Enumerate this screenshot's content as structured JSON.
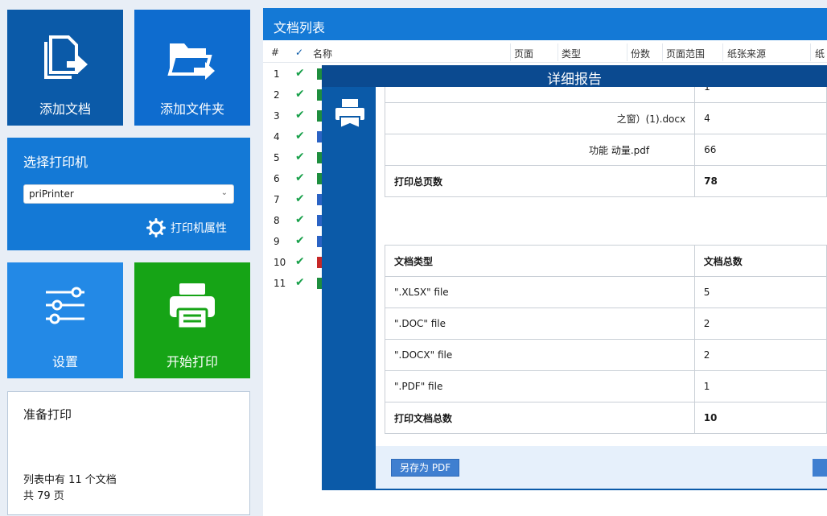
{
  "tiles": {
    "add_document": "添加文档",
    "add_folder": "添加文件夹",
    "settings": "设置",
    "start_print": "开始打印"
  },
  "printer_panel": {
    "title": "选择打印机",
    "selected_printer": "priPrinter",
    "properties_label": "打印机属性"
  },
  "status_panel": {
    "title": "准备打印",
    "doc_count_text": "列表中有 11 个文档",
    "page_count_text": "共 79 页"
  },
  "doc_list": {
    "title": "文档列表",
    "columns": [
      "#",
      "名称",
      "页面",
      "类型",
      "份数",
      "页面范围",
      "纸张来源",
      "纸"
    ],
    "rows": [
      {
        "num": "1",
        "icon_color": "#1e8e3e"
      },
      {
        "num": "2",
        "icon_color": "#1e8e3e"
      },
      {
        "num": "3",
        "icon_color": "#1e8e3e"
      },
      {
        "num": "4",
        "icon_color": "#2b63c4"
      },
      {
        "num": "5",
        "icon_color": "#1e8e3e"
      },
      {
        "num": "6",
        "icon_color": "#1e8e3e"
      },
      {
        "num": "7",
        "icon_color": "#2b63c4"
      },
      {
        "num": "8",
        "icon_color": "#2b63c4"
      },
      {
        "num": "9",
        "icon_color": "#2b63c4"
      },
      {
        "num": "10",
        "icon_color": "#c62828"
      },
      {
        "num": "11",
        "icon_color": "#1e8e3e"
      }
    ]
  },
  "report": {
    "title": "详细报告",
    "pages_rows": [
      {
        "name": "",
        "value": "1"
      },
      {
        "name": "之窗）(1).docx",
        "value": "4"
      },
      {
        "name": "功能  动量.pdf",
        "value": "66"
      }
    ],
    "pages_total_label": "打印总页数",
    "pages_total_value": "78",
    "type_header": "文档类型",
    "count_header": "文档总数",
    "type_rows": [
      {
        "type": "\".XLSX\" file",
        "count": "5"
      },
      {
        "type": "\".DOC\" file",
        "count": "2"
      },
      {
        "type": "\".DOCX\" file",
        "count": "2"
      },
      {
        "type": "\".PDF\" file",
        "count": "1"
      }
    ],
    "docs_total_label": "打印文档总数",
    "docs_total_value": "10",
    "save_pdf_label": "另存为 PDF"
  },
  "colors": {
    "tile_dark_blue": "#0b5aa8",
    "tile_blue": "#0e6ccf",
    "tile_light_blue": "#2389e6",
    "tile_green": "#16a416",
    "check_green": "#18a04a"
  }
}
